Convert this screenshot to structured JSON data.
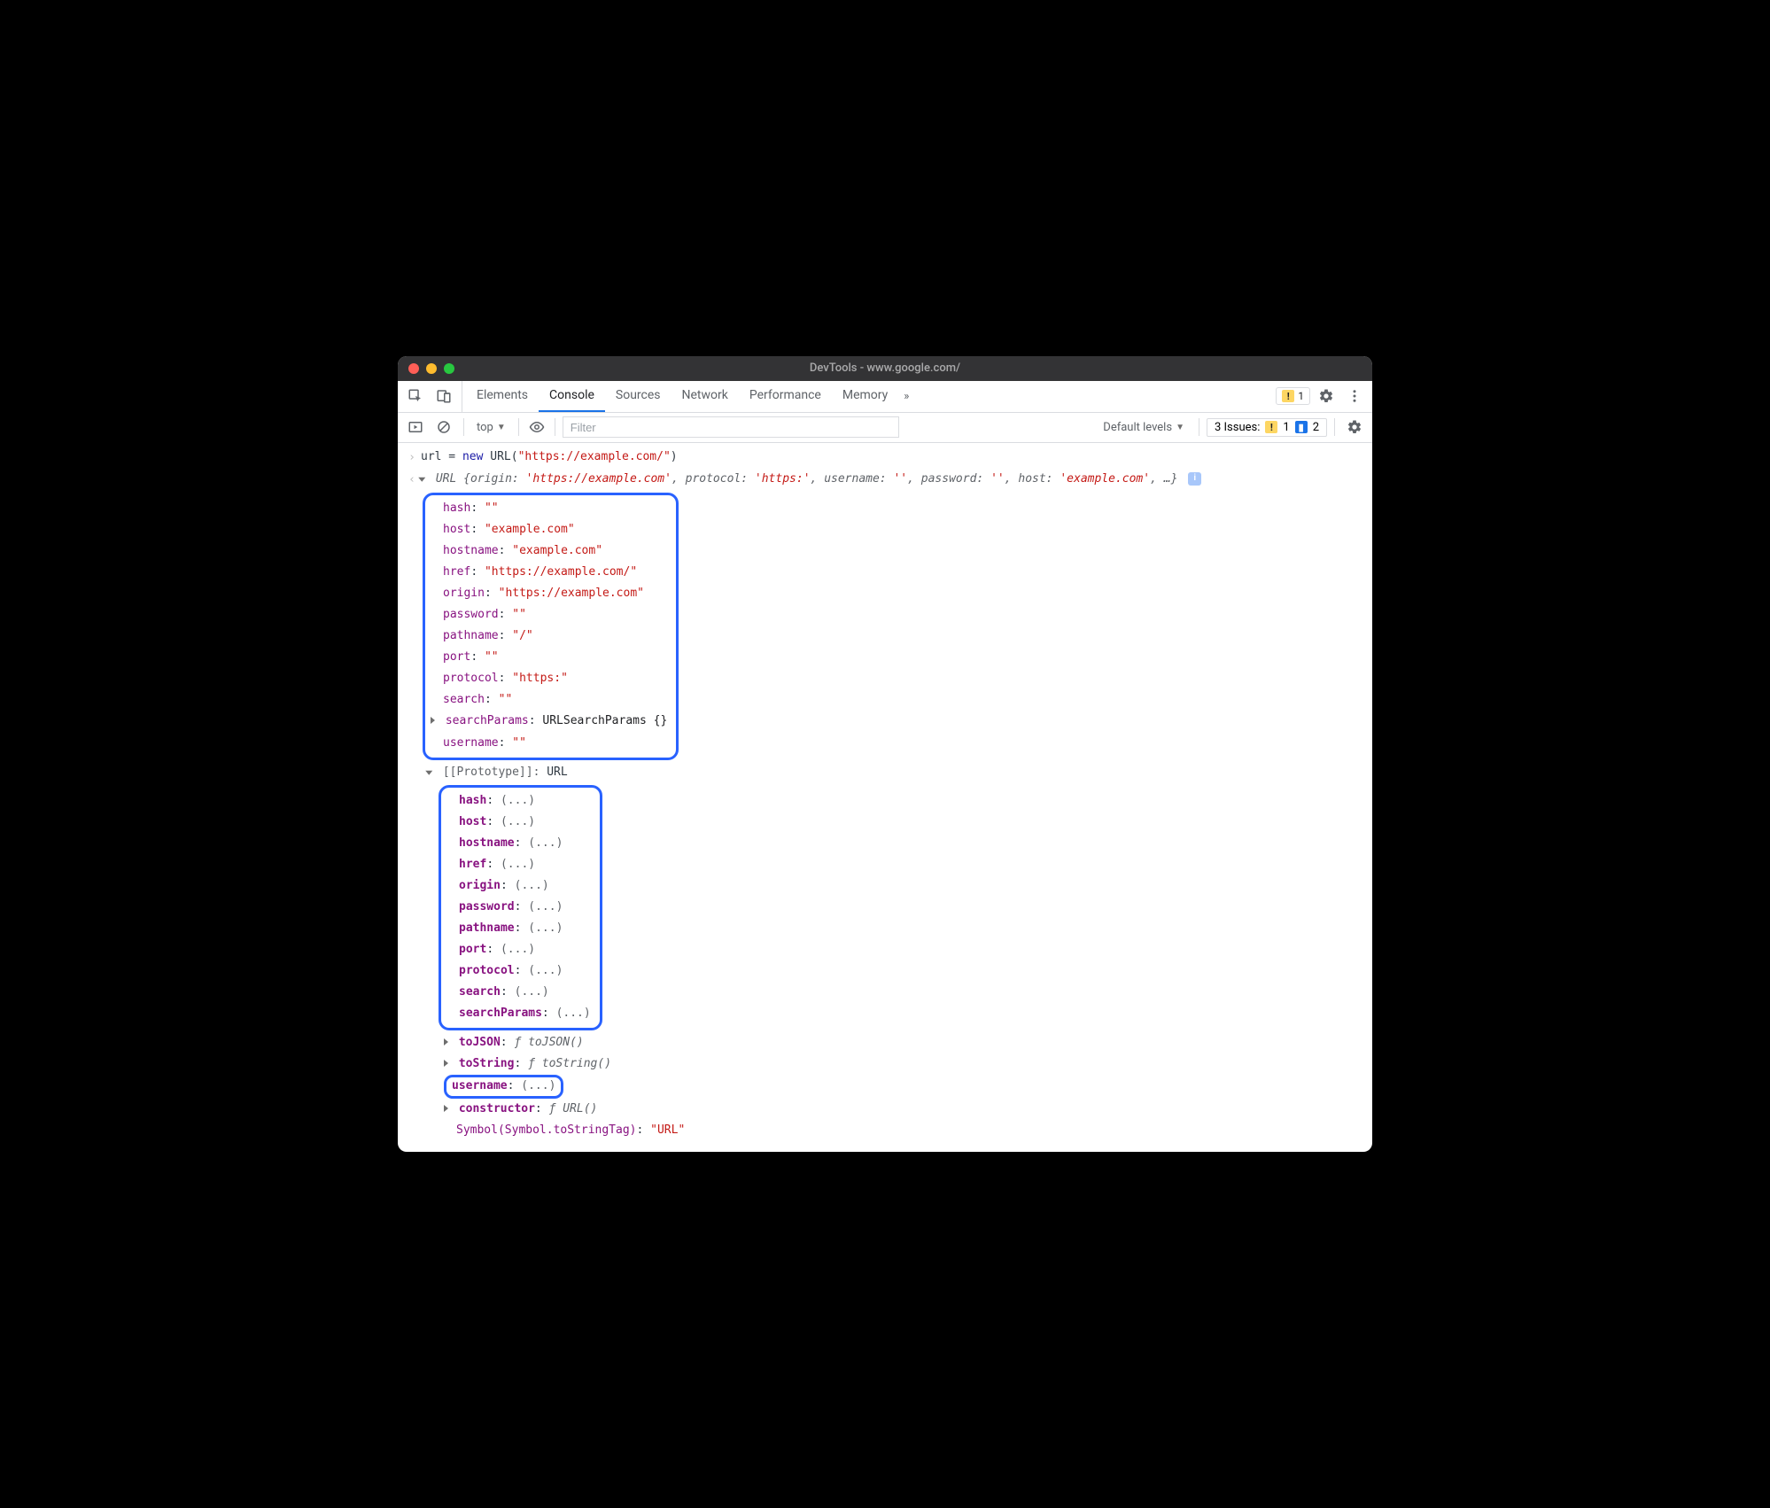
{
  "titlebar": {
    "title": "DevTools - www.google.com/"
  },
  "tabs": {
    "items": [
      "Elements",
      "Console",
      "Sources",
      "Network",
      "Performance",
      "Memory"
    ],
    "active_index": 1,
    "more_glyph": "»"
  },
  "topRight": {
    "warn_count": "1"
  },
  "subbar": {
    "context": "top",
    "filter_placeholder": "Filter",
    "levels_label": "Default levels",
    "issues_label": "3 Issues:",
    "warn_count": "1",
    "info_count": "2"
  },
  "console": {
    "input_pre": "url = ",
    "input_new": "new",
    "input_class": " URL(",
    "input_arg": "\"https://example.com/\"",
    "input_close": ")",
    "summary_class": "URL ",
    "summary_pairs": [
      {
        "k": "origin",
        "v": "'https://example.com'"
      },
      {
        "k": "protocol",
        "v": "'https:'"
      },
      {
        "k": "username",
        "v": "''"
      },
      {
        "k": "password",
        "v": "''"
      },
      {
        "k": "host",
        "v": "'example.com'"
      }
    ],
    "summary_more": ", …}",
    "props": [
      {
        "k": "hash",
        "v": "\"\""
      },
      {
        "k": "host",
        "v": "\"example.com\""
      },
      {
        "k": "hostname",
        "v": "\"example.com\""
      },
      {
        "k": "href",
        "v": "\"https://example.com/\""
      },
      {
        "k": "origin",
        "v": "\"https://example.com\""
      },
      {
        "k": "password",
        "v": "\"\""
      },
      {
        "k": "pathname",
        "v": "\"/\""
      },
      {
        "k": "port",
        "v": "\"\""
      },
      {
        "k": "protocol",
        "v": "\"https:\""
      },
      {
        "k": "search",
        "v": "\"\""
      }
    ],
    "searchParams_key": "searchParams",
    "searchParams_val": "URLSearchParams {}",
    "username_key": "username",
    "username_val": "\"\"",
    "prototype_label": "[[Prototype]]",
    "prototype_class": "URL",
    "proto_props": [
      "hash",
      "host",
      "hostname",
      "href",
      "origin",
      "password",
      "pathname",
      "port",
      "protocol",
      "search",
      "searchParams"
    ],
    "proto_ellipsis": "(...)",
    "toJSON_key": "toJSON",
    "toJSON_val": "toJSON()",
    "toString_key": "toString",
    "toString_val": "toString()",
    "proto_username_key": "username",
    "constructor_key": "constructor",
    "constructor_val": "URL()",
    "symbol_name": "Symbol(Symbol.toStringTag)",
    "symbol_val": "\"URL\"",
    "f_glyph": "ƒ"
  }
}
